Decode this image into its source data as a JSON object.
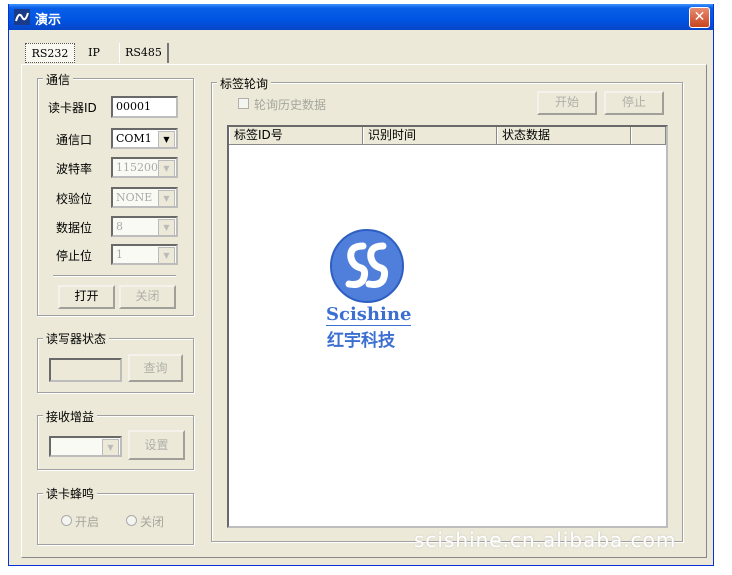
{
  "window": {
    "title": "演示",
    "close_glyph": "✕"
  },
  "tabs": [
    {
      "label": "RS232",
      "active": true
    },
    {
      "label": "IP",
      "active": false
    },
    {
      "label": "RS485",
      "active": false
    }
  ],
  "comm": {
    "group_title": "通信",
    "reader_id_label": "读卡器ID",
    "reader_id_value": "00001",
    "port_label": "通信口",
    "port_value": "COM1",
    "baud_label": "波特率",
    "baud_value": "115200",
    "parity_label": "校验位",
    "parity_value": "NONE",
    "databits_label": "数据位",
    "databits_value": "8",
    "stopbits_label": "停止位",
    "stopbits_value": "1",
    "open_button": "打开",
    "close_button": "关闭"
  },
  "reader_status": {
    "group_title": "读写器状态",
    "query_button": "查询"
  },
  "gain": {
    "group_title": "接收增益",
    "set_button": "设置"
  },
  "buzzer": {
    "group_title": "读卡蜂鸣",
    "on_label": "开启",
    "off_label": "关闭"
  },
  "polling": {
    "group_title": "标签轮询",
    "history_checkbox_label": "轮询历史数据",
    "start_button": "开始",
    "stop_button": "停止",
    "columns": [
      "标签ID号",
      "识别时间",
      "状态数据"
    ]
  },
  "logo": {
    "name": "Scishine",
    "cn_name": "红宇科技"
  },
  "watermark": "scishine.cn.alibaba.com",
  "colors": {
    "titlebar": "#0054e3",
    "dialog_bg": "#ece9d8",
    "logo_blue": "#3b6fd1"
  }
}
